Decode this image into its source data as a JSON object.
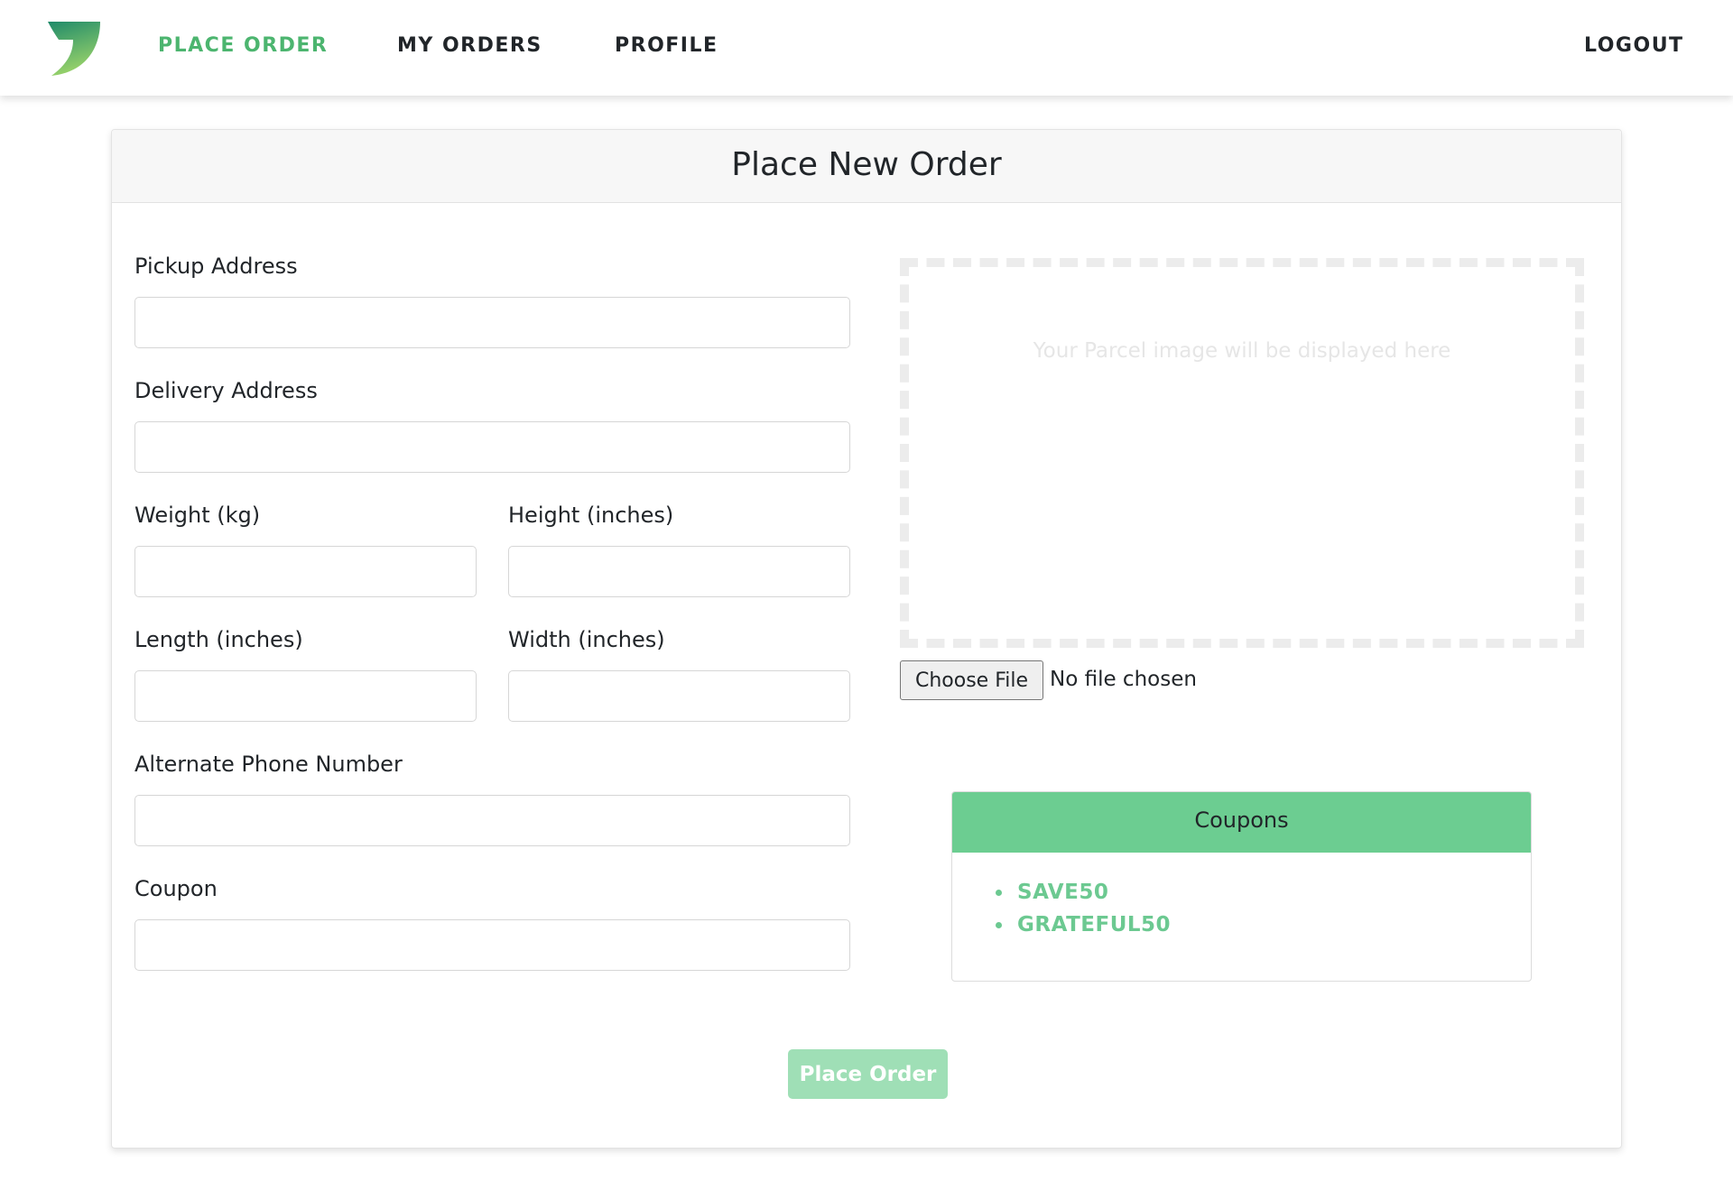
{
  "nav": {
    "logo": "leaf-logo-icon",
    "items": [
      {
        "label": "PLACE ORDER",
        "active": true
      },
      {
        "label": "MY ORDERS",
        "active": false
      },
      {
        "label": "PROFILE",
        "active": false
      }
    ],
    "logout_label": "LOGOUT",
    "active_color": "#4cb56f"
  },
  "card": {
    "title": "Place New Order"
  },
  "form": {
    "pickup_label": "Pickup Address",
    "pickup_value": "",
    "delivery_label": "Delivery Address",
    "delivery_value": "",
    "weight_label": "Weight (kg)",
    "weight_value": "",
    "height_label": "Height (inches)",
    "height_value": "",
    "length_label": "Length (inches)",
    "length_value": "",
    "width_label": "Width (inches)",
    "width_value": "",
    "phone_label": "Alternate Phone Number",
    "phone_value": "",
    "coupon_label": "Coupon",
    "coupon_value": ""
  },
  "upload": {
    "placeholder": "Your Parcel image will be displayed here",
    "button_label": "Choose File",
    "status": "No file chosen"
  },
  "coupons": {
    "title": "Coupons",
    "items": [
      "SAVE50",
      "GRATEFUL50"
    ],
    "header_color": "#6ccd91"
  },
  "submit": {
    "label": "Place Order",
    "disabled": true
  }
}
